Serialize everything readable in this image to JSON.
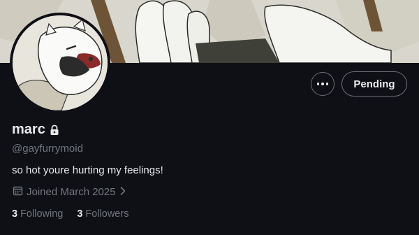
{
  "profile": {
    "display_name": "marc",
    "handle": "@gayfurrymoid",
    "bio": "so hot youre hurting my feelings!",
    "joined": "Joined March 2025"
  },
  "actions": {
    "follow_state_label": "Pending"
  },
  "stats": {
    "following_count": "3",
    "following_label": "Following",
    "followers_count": "3",
    "followers_label": "Followers"
  },
  "colors": {
    "background": "#0f1016",
    "text_primary": "#e7e9ea",
    "text_secondary": "#71767b",
    "button_border": "#6b6f76"
  }
}
